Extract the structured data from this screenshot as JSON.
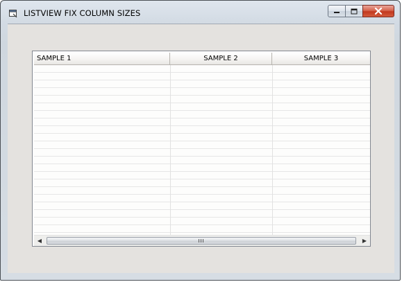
{
  "window": {
    "title": "LISTVIEW FIX COLUMN SIZES",
    "app_icon": "window-app-icon",
    "controls": {
      "minimize_icon": "minimize-icon",
      "maximize_icon": "maximize-icon",
      "close_icon": "close-icon"
    }
  },
  "listview": {
    "columns": [
      {
        "label": "SAMPLE 1",
        "align": "left"
      },
      {
        "label": "SAMPLE 2",
        "align": "center"
      },
      {
        "label": "SAMPLE 3",
        "align": "center"
      }
    ],
    "rows": [],
    "gridlines": true,
    "horizontal_scrollbar": {
      "left_arrow": "◀",
      "right_arrow": "▶",
      "thumb_grip": "grip-icon"
    }
  },
  "colors": {
    "close_button": "#c9452b",
    "client_background": "#e4e2df",
    "gridline": "#e6e6e6"
  }
}
